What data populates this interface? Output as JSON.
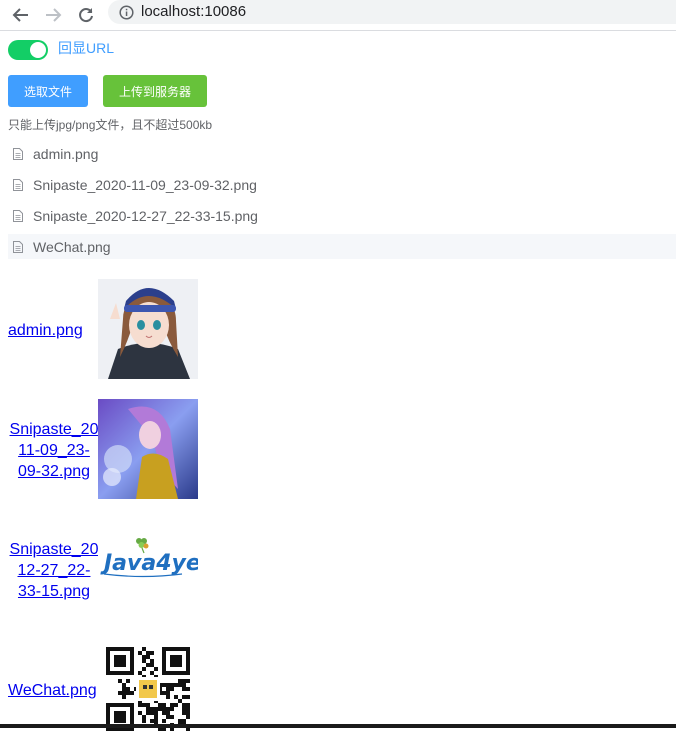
{
  "browser": {
    "url": "localhost:10086"
  },
  "toggle": {
    "label": "回显URL",
    "on": true,
    "color": "#13ce66"
  },
  "buttons": {
    "select_label": "选取文件",
    "upload_label": "上传到服务器"
  },
  "tip": "只能上传jpg/png文件，且不超过500kb",
  "files": [
    {
      "name": "admin.png"
    },
    {
      "name": "Snipaste_2020-11-09_23-09-32.png"
    },
    {
      "name": "Snipaste_2020-12-27_22-33-15.png"
    },
    {
      "name": "WeChat.png"
    }
  ],
  "previews": [
    {
      "line1": "admin.png",
      "line2": "",
      "line3": ""
    },
    {
      "line1": "Snipaste_20",
      "line2": "11-09_23-",
      "line3": "09-32.png"
    },
    {
      "line1": "Snipaste_20",
      "line2": "12-27_22-",
      "line3": "33-15.png"
    },
    {
      "line1": "WeChat.png",
      "line2": "",
      "line3": ""
    }
  ],
  "logo_text": "Java4ye",
  "colors": {
    "primary": "#409eff",
    "success": "#67c23a",
    "link": "#0000ee"
  }
}
